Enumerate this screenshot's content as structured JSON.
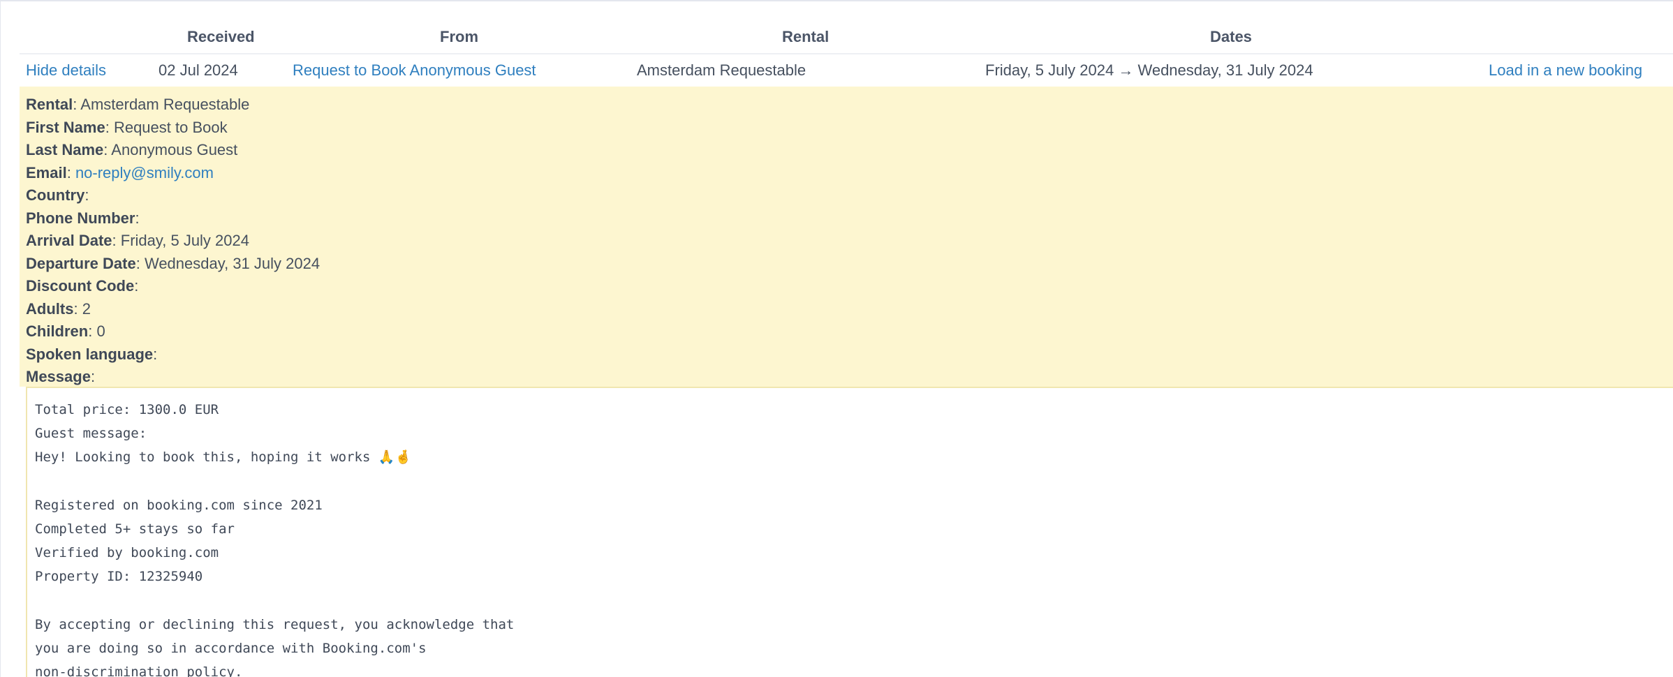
{
  "table": {
    "headers": {
      "received": "Received",
      "from": "From",
      "rental": "Rental",
      "dates": "Dates"
    },
    "row": {
      "hide_details": "Hide details",
      "received": "02 Jul 2024",
      "from": "Request to Book Anonymous Guest",
      "rental": "Amsterdam Requestable",
      "dates": "Friday, 5 July 2024 → Wednesday, 31 July 2024",
      "load_booking": "Load in a new booking"
    }
  },
  "details": {
    "rental": {
      "label": "Rental",
      "value": "Amsterdam Requestable"
    },
    "first_name": {
      "label": "First Name",
      "value": "Request to Book"
    },
    "last_name": {
      "label": "Last Name",
      "value": "Anonymous Guest"
    },
    "email": {
      "label": "Email",
      "value": "no-reply@smily.com"
    },
    "country": {
      "label": "Country",
      "value": ""
    },
    "phone": {
      "label": "Phone Number",
      "value": ""
    },
    "arrival": {
      "label": "Arrival Date",
      "value": "Friday, 5 July 2024"
    },
    "departure": {
      "label": "Departure Date",
      "value": "Wednesday, 31 July 2024"
    },
    "discount": {
      "label": "Discount Code",
      "value": ""
    },
    "adults": {
      "label": "Adults",
      "value": "2"
    },
    "children": {
      "label": "Children",
      "value": "0"
    },
    "language": {
      "label": "Spoken language",
      "value": ""
    },
    "message": {
      "label": "Message",
      "value": ""
    }
  },
  "message_lines": [
    "Total price: 1300.0 EUR",
    "Guest message:",
    "Hey! Looking to book this, hoping it works 🙏🤞",
    "",
    "Registered on booking.com since 2021",
    "Completed 5+ stays so far",
    "Verified by booking.com",
    "Property ID: 12325940",
    "",
    "By accepting or declining this request, you acknowledge that",
    "you are doing so in accordance with Booking.com's",
    "non-discrimination policy."
  ]
}
